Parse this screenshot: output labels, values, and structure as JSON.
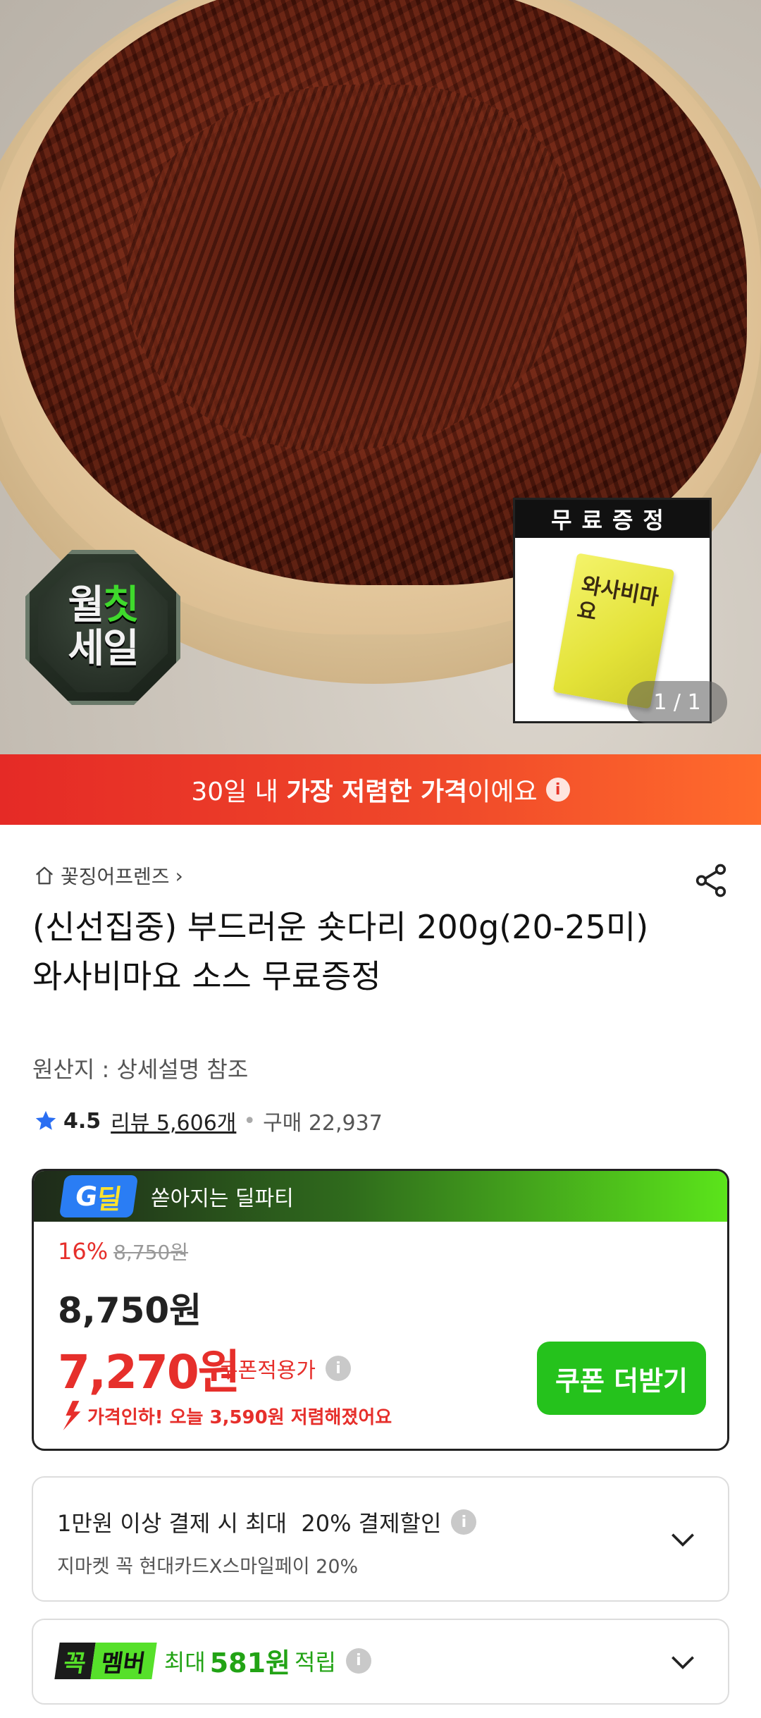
{
  "hero": {
    "sale_badge": {
      "line1a": "월",
      "line1b": "칫",
      "line2": "세일"
    },
    "gift": {
      "header": "무료증정",
      "product_text": "와사비마요"
    },
    "pager": "1 / 1"
  },
  "lowest_price_banner": {
    "prefix": "30일 내 ",
    "highlight": "가장 저렴한 가격",
    "suffix": "이에요",
    "info_glyph": "i"
  },
  "product": {
    "store_name": "꽃징어프렌즈",
    "store_chevron": "›",
    "title": "(신선집중) 부드러운 숏다리 200g(20-25미) 와사비마요 소스 무료증정",
    "origin": "원산지 : 상세설명 참조",
    "rating": {
      "score": "4.5",
      "reviews": "리뷰 5,606개",
      "separator": "•",
      "purchases": "구매 22,937"
    }
  },
  "deal": {
    "logo_text_a": "G",
    "logo_text_b": "딜",
    "header_text": "쏟아지는 딜파티",
    "discount_rate": "16%",
    "original_price": "8,750원",
    "price": "8,750원",
    "coupon_price": "7,270원",
    "coupon_label": "쿠폰적용가",
    "info_glyph": "i",
    "price_drop": "가격인하! 오늘 3,590원 저렴해졌어요",
    "coupon_button": "쿠폰 더받기"
  },
  "payment": {
    "main": "1만원 이상 결제 시 최대  20% 결제할인",
    "sub": "지마켓 꼭 현대카드X스마일페이 20%",
    "info_glyph": "i"
  },
  "membership": {
    "logo_a": "꼭",
    "logo_b": "멤버",
    "prefix": "최대",
    "amount": "581원",
    "suffix": "적립",
    "info_glyph": "i"
  },
  "colors": {
    "accent_red": "#e62f2b",
    "accent_green": "#25c21c",
    "rating_star": "#2a6ef2"
  },
  "icons": [
    "home-icon",
    "share-icon",
    "star-icon",
    "info-icon",
    "chevron-down-icon",
    "down-arrow-icon"
  ]
}
